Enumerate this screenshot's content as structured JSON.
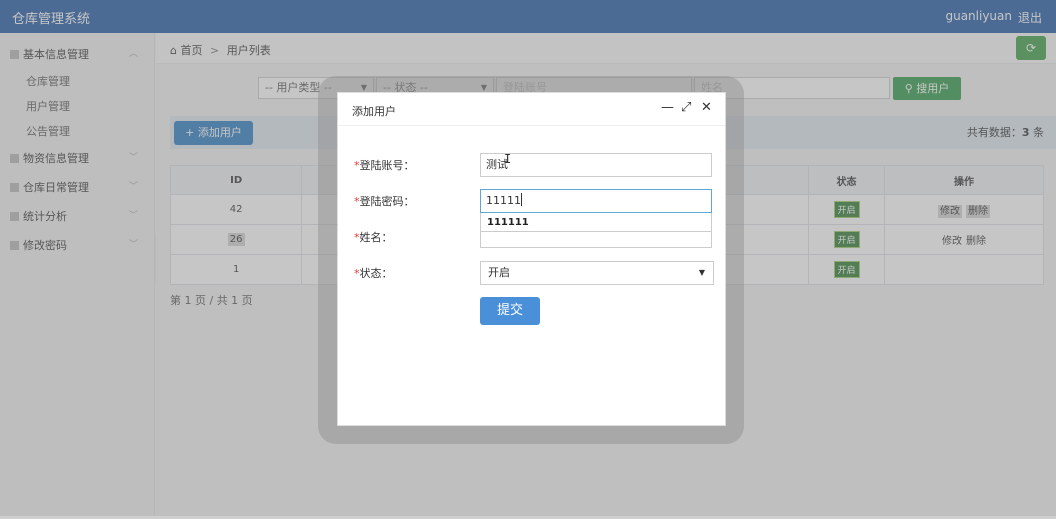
{
  "app": {
    "title": "仓库管理系统",
    "username": "guanliyuan",
    "logout": "退出"
  },
  "sidebar": {
    "groups": [
      {
        "label": "基本信息管理",
        "chevron": "︿",
        "items": [
          "仓库管理",
          "用户管理",
          "公告管理"
        ]
      },
      {
        "label": "物资信息管理",
        "chevron": "﹀"
      },
      {
        "label": "仓库日常管理",
        "chevron": "﹀"
      },
      {
        "label": "统计分析",
        "chevron": "﹀"
      },
      {
        "label": "修改密码",
        "chevron": "﹀"
      }
    ],
    "collapse_icon": "◀"
  },
  "breadcrumb": {
    "home": "首页",
    "separator": ">",
    "current": "用户列表"
  },
  "filters": {
    "user_type": "-- 用户类型 --",
    "status": "-- 状态 --",
    "account_placeholder": "登陆账号",
    "name_placeholder": "姓名",
    "search_label": "搜用户"
  },
  "toolbar": {
    "add_label": "添加用户",
    "total_prefix": "共有数据：",
    "total_count": "3",
    "total_suffix": " 条"
  },
  "table": {
    "columns": {
      "id": "ID",
      "status": "状态",
      "ops": "操作"
    },
    "rows": [
      {
        "id": "42",
        "status": "开启",
        "edit": "修改",
        "delete": "删除"
      },
      {
        "id": "26",
        "status": "开启",
        "edit": "修改",
        "delete": "删除"
      },
      {
        "id": "1",
        "status": "开启",
        "edit": "",
        "delete": ""
      }
    ]
  },
  "pager": "第 1 页 / 共 1 页",
  "modal": {
    "title": "添加用户",
    "controls": {
      "minimize": "—",
      "maximize": "⤢",
      "close": "✕"
    },
    "fields": {
      "account_label": "登陆账号：",
      "account_value": "测试",
      "password_label": "登陆密码：",
      "password_value": "11111",
      "autocomplete": "111111",
      "name_label": "姓名：",
      "name_value": "",
      "status_label": "状态：",
      "status_value": "开启"
    },
    "required_mark": "*",
    "submit": "提交"
  },
  "colors": {
    "topbar": "#1f5aa6",
    "primary": "#2b7cc1",
    "success": "#2f9a4b",
    "badge": "#2e7d32",
    "required": "#e53935"
  }
}
